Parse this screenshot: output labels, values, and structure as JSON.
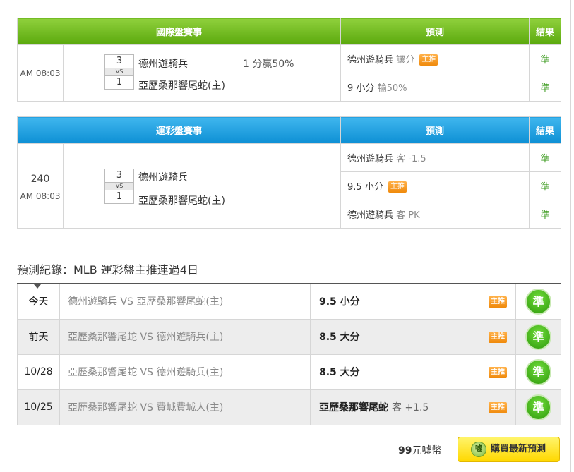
{
  "international": {
    "headers": {
      "event": "國際盤賽事",
      "prediction": "預測",
      "result": "結果"
    },
    "time": "AM 08:03",
    "score_away": "3",
    "vs": "VS",
    "score_home": "1",
    "team_away": "德州遊騎兵",
    "team_home": "亞歷桑那響尾蛇(主)",
    "handicap": "1 分贏50%",
    "predictions": [
      {
        "main": "德州遊騎兵",
        "detail": "讓分",
        "badge": "主推",
        "result": "準"
      },
      {
        "main": "9 小分",
        "detail": "輸50%",
        "badge": "",
        "result": "準"
      }
    ]
  },
  "lottery": {
    "headers": {
      "event": "運彩盤賽事",
      "prediction": "預測",
      "result": "結果"
    },
    "number": "240",
    "time": "AM 08:03",
    "score_away": "3",
    "vs": "VS",
    "score_home": "1",
    "team_away": "德州遊騎兵",
    "team_home": "亞歷桑那響尾蛇(主)",
    "predictions": [
      {
        "main": "德州遊騎兵",
        "detail": "客 -1.5",
        "badge": "",
        "result": "準"
      },
      {
        "main": "9.5 小分",
        "detail": "",
        "badge": "主推",
        "result": "準"
      },
      {
        "main": "德州遊騎兵",
        "detail": "客 PK",
        "badge": "",
        "result": "準"
      }
    ]
  },
  "record": {
    "title": "預測紀錄：MLB 運彩盤主推連過4日",
    "rows": [
      {
        "day": "今天",
        "match": "德州遊騎兵 VS 亞歷桑那響尾蛇(主)",
        "pick": "9.5 小分",
        "pick_detail": "",
        "badge": "主推",
        "result": "準"
      },
      {
        "day": "前天",
        "match": "亞歷桑那響尾蛇 VS 德州遊騎兵(主)",
        "pick": "8.5 大分",
        "pick_detail": "",
        "badge": "主推",
        "result": "準"
      },
      {
        "day": "10/28",
        "match": "亞歷桑那響尾蛇 VS 德州遊騎兵(主)",
        "pick": "8.5 大分",
        "pick_detail": "",
        "badge": "主推",
        "result": "準"
      },
      {
        "day": "10/25",
        "match": "亞歷桑那響尾蛇 VS 費城費城人(主)",
        "pick": "亞歷桑那響尾蛇",
        "pick_detail": "客 +1.5",
        "badge": "主推",
        "result": "準"
      }
    ]
  },
  "footer": {
    "price": "99",
    "currency": "元噓幣",
    "coin_text": "噓",
    "buy_label": "購買最新預測"
  },
  "colors": {
    "intl_header": "#6cb61c",
    "lottery_header": "#1d9fe0",
    "result_text": "#3a9a1c",
    "badge": "#f59a1f",
    "buy_button": "#ffe400"
  }
}
